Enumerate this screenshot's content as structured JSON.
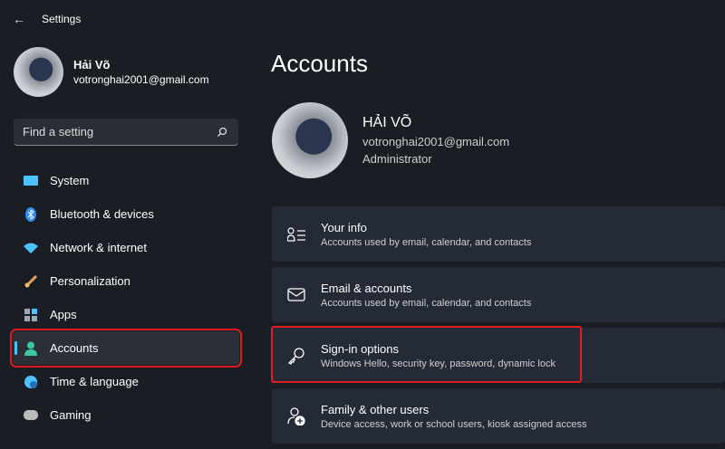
{
  "window": {
    "title": "Settings"
  },
  "profile": {
    "name": "Hải Võ",
    "email": "votronghai2001@gmail.com"
  },
  "search": {
    "placeholder": "Find a setting"
  },
  "nav": [
    {
      "label": "System",
      "icon": "monitor-icon",
      "color": "#4cc2ff"
    },
    {
      "label": "Bluetooth & devices",
      "icon": "bluetooth-icon",
      "color": "#2f8cf0"
    },
    {
      "label": "Network & internet",
      "icon": "wifi-icon",
      "color": "#4cc2ff"
    },
    {
      "label": "Personalization",
      "icon": "brush-icon",
      "color": "#e8a060"
    },
    {
      "label": "Apps",
      "icon": "apps-icon",
      "color": "#9ab"
    },
    {
      "label": "Accounts",
      "icon": "person-icon",
      "color": "#3cc8a0"
    },
    {
      "label": "Time & language",
      "icon": "globe-clock-icon",
      "color": "#4cc2ff"
    },
    {
      "label": "Gaming",
      "icon": "gamepad-icon",
      "color": "#bbb"
    }
  ],
  "page": {
    "title": "Accounts"
  },
  "account": {
    "name": "HẢI VÕ",
    "email": "votronghai2001@gmail.com",
    "role": "Administrator"
  },
  "cards": [
    {
      "title": "Your info",
      "desc": "Accounts used by email, calendar, and contacts"
    },
    {
      "title": "Email & accounts",
      "desc": "Accounts used by email, calendar, and contacts"
    },
    {
      "title": "Sign-in options",
      "desc": "Windows Hello, security key, password, dynamic lock"
    },
    {
      "title": "Family & other users",
      "desc": "Device access, work or school users, kiosk assigned access"
    }
  ]
}
